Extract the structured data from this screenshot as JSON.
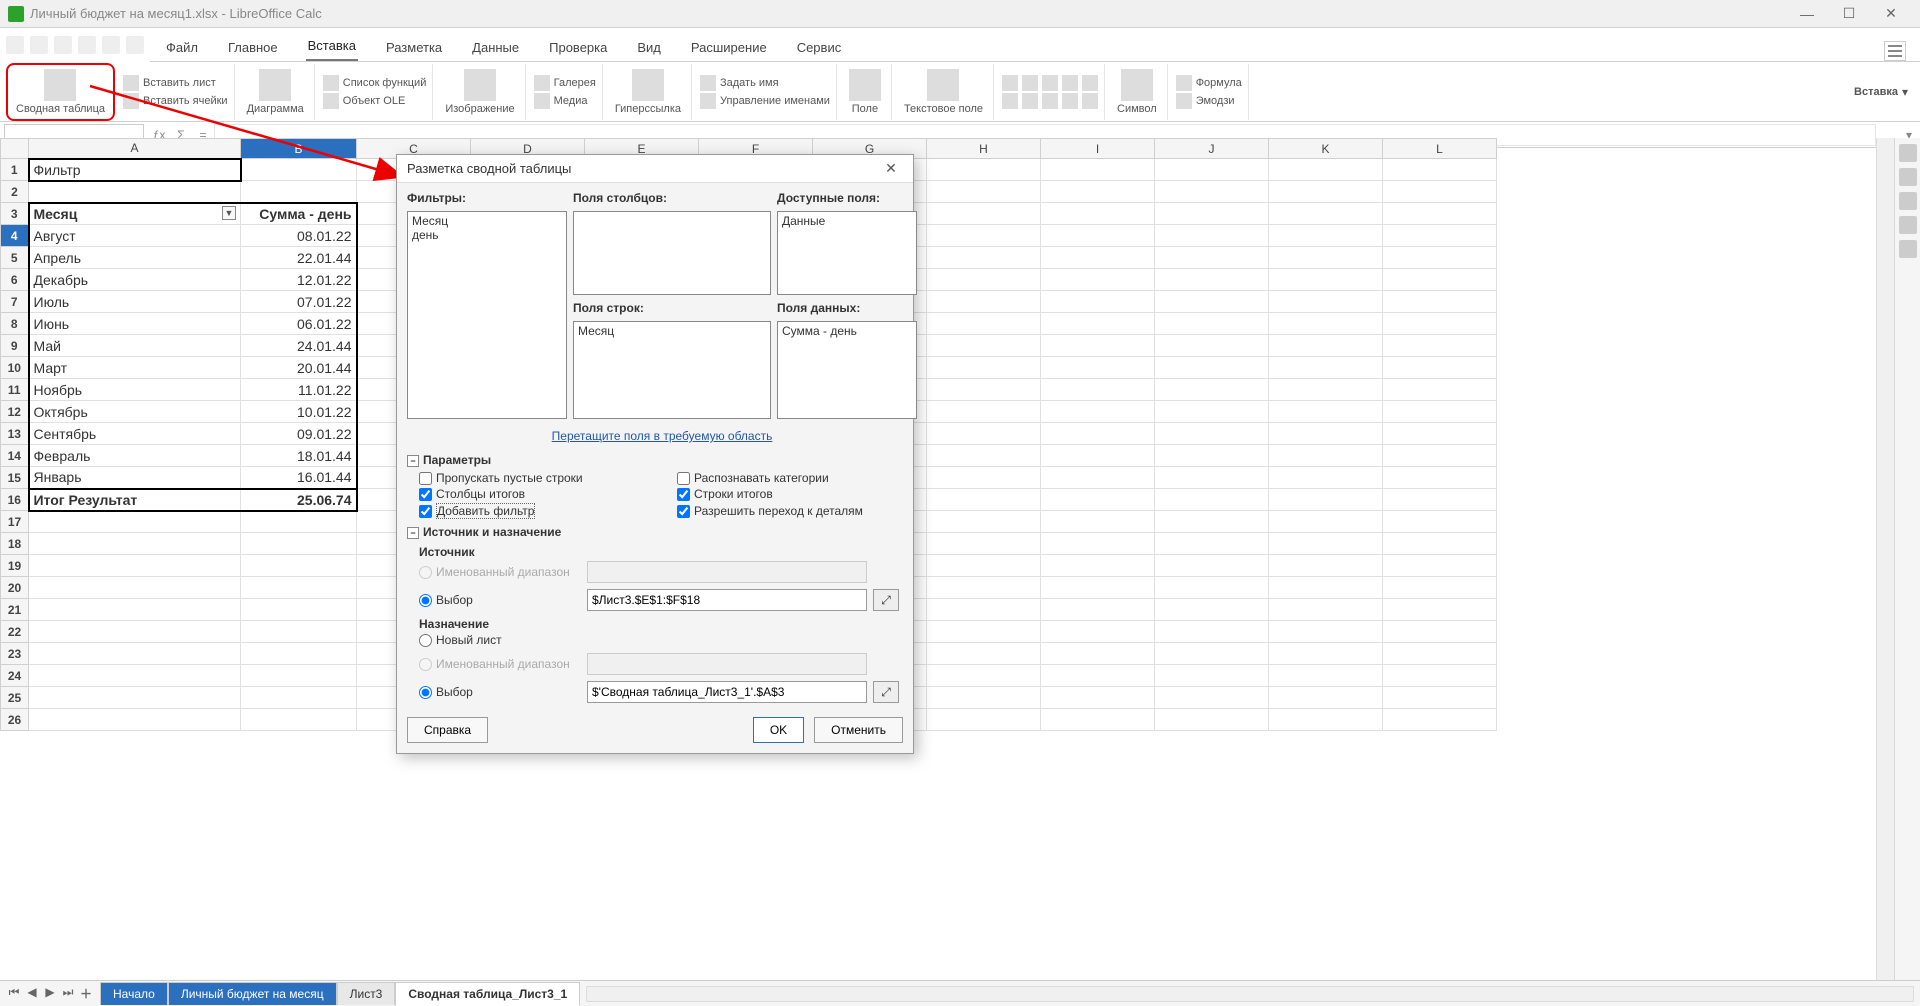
{
  "window": {
    "title": "Личный бюджет на месяц1.xlsx - LibreOffice Calc"
  },
  "tabs": {
    "file": "Файл",
    "main": "Главное",
    "insert": "Вставка",
    "layout": "Разметка",
    "data": "Данные",
    "review": "Проверка",
    "view": "Вид",
    "extension": "Расширение",
    "service": "Сервис"
  },
  "ribbon": {
    "pivotTable": "Сводная таблица",
    "insertSheet": "Вставить лист",
    "insertCells": "Вставить ячейки",
    "chart": "Диаграмма",
    "funcList": "Список функций",
    "oleObject": "Объект OLE",
    "image": "Изображение",
    "gallery": "Галерея",
    "media": "Медиа",
    "hyperlink": "Гиперссылка",
    "setName": "Задать имя",
    "manageNames": "Управление именами",
    "field": "Поле",
    "textBox": "Текстовое поле",
    "symbol": "Символ",
    "formula": "Формула",
    "emoji": "Эмодзи",
    "insertBtn": "Вставка"
  },
  "columns": [
    "A",
    "B",
    "C",
    "D",
    "E",
    "F",
    "G",
    "H",
    "I",
    "J",
    "K",
    "L"
  ],
  "pivot": {
    "filterLabel": "Фильтр",
    "monthHeader": "Месяц",
    "sumHeader": "Сумма - день",
    "rows": [
      {
        "month": "Август",
        "val": "08.01.22"
      },
      {
        "month": "Апрель",
        "val": "22.01.44"
      },
      {
        "month": "Декабрь",
        "val": "12.01.22"
      },
      {
        "month": "Июль",
        "val": "07.01.22"
      },
      {
        "month": "Июнь",
        "val": "06.01.22"
      },
      {
        "month": "Май",
        "val": "24.01.44"
      },
      {
        "month": "Март",
        "val": "20.01.44"
      },
      {
        "month": "Ноябрь",
        "val": "11.01.22"
      },
      {
        "month": "Октябрь",
        "val": "10.01.22"
      },
      {
        "month": "Сентябрь",
        "val": "09.01.22"
      },
      {
        "month": "Февраль",
        "val": "18.01.44"
      },
      {
        "month": "Январь",
        "val": "16.01.44"
      }
    ],
    "totalLabel": "Итог Результат",
    "totalVal": "25.06.74"
  },
  "dialog": {
    "title": "Разметка сводной таблицы",
    "filters": "Фильтры:",
    "colFields": "Поля столбцов:",
    "colFieldsItem": "Данные",
    "availFields": "Доступные поля:",
    "availItems": [
      "Месяц",
      "день"
    ],
    "rowFields": "Поля строк:",
    "rowFieldsItems": [
      "Месяц"
    ],
    "dataFields": "Поля данных:",
    "dataFieldsItems": [
      "Сумма - день"
    ],
    "dragHint": "Перетащите поля в требуемую область",
    "params": "Параметры",
    "chkSkipEmpty": "Пропускать пустые строки",
    "chkRecognizeCat": "Распознавать категории",
    "chkTotalCols": "Столбцы итогов",
    "chkTotalRows": "Строки итогов",
    "chkAddFilter": "Добавить фильтр",
    "chkDrillDetails": "Разрешить переход к деталям",
    "srcDst": "Источник и назначение",
    "source": "Источник",
    "namedRange": "Именованный диапазон",
    "selection": "Выбор",
    "srcValue": "$Лист3.$E$1:$F$18",
    "destination": "Назначение",
    "newSheet": "Новый лист",
    "dstValue": "$'Сводная таблица_Лист3_1'.$A$3",
    "help": "Справка",
    "ok": "OK",
    "cancel": "Отменить"
  },
  "sheetTabs": {
    "start": "Начало",
    "budget": "Личный бюджет на месяц",
    "sheet3": "Лист3",
    "pivot": "Сводная таблица_Лист3_1"
  }
}
